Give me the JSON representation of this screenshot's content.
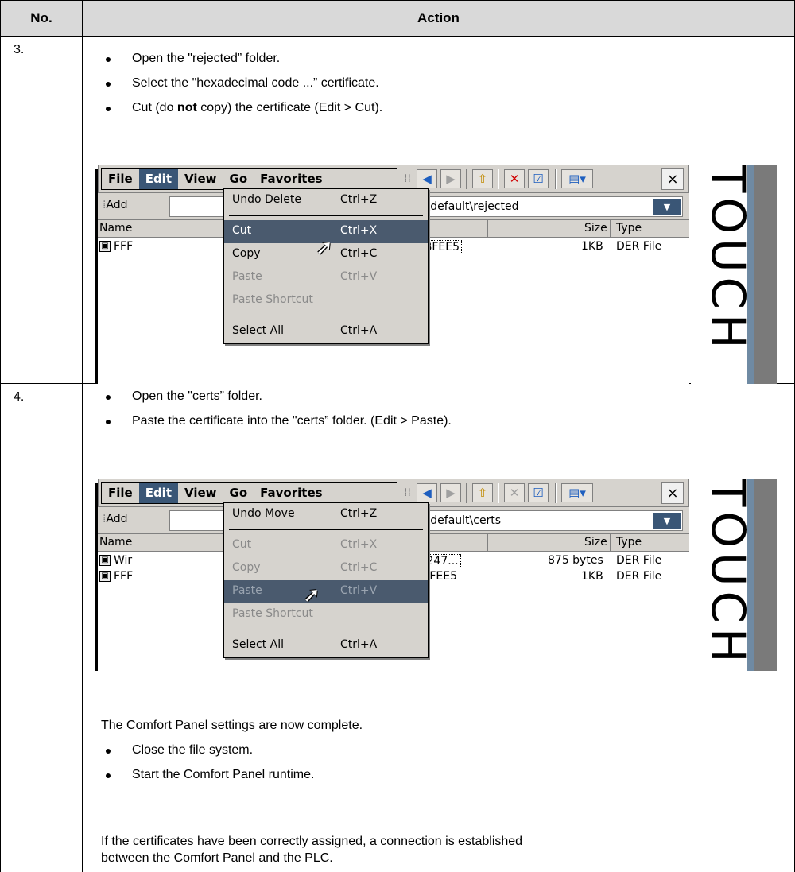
{
  "table": {
    "header_no": "No.",
    "header_action": "Action"
  },
  "rows": [
    {
      "no": "3.",
      "bullets": [
        "Open the \"rejected” folder.",
        "Select the \"hexadecimal code ...” certificate.",
        [
          "Cut (do ",
          "not",
          " copy) the certificate (Edit > Cut)."
        ]
      ],
      "screenshot": {
        "menu": [
          "File",
          "Edit",
          "View",
          "Go",
          "Favorites"
        ],
        "address_label": "Add",
        "address": "ot\\OPC\\PKI\\CA\\default\\rejected",
        "columns": [
          "Name",
          "Size",
          "Type"
        ],
        "files": [
          {
            "name": "FFF",
            "tail": "9000492A54BFEE5",
            "size": "1KB",
            "type": "DER File"
          }
        ],
        "dropdown": [
          {
            "label": "Undo Delete",
            "key": "Ctrl+Z",
            "state": "normal"
          },
          {
            "label": "Cut",
            "key": "Ctrl+X",
            "state": "highlight"
          },
          {
            "label": "Copy",
            "key": "Ctrl+C",
            "state": "normal"
          },
          {
            "label": "Paste",
            "key": "Ctrl+V",
            "state": "disabled"
          },
          {
            "label": "Paste Shortcut",
            "key": "",
            "state": "disabled"
          },
          {
            "label": "Select All",
            "key": "Ctrl+A",
            "state": "normal"
          }
        ],
        "close": "×",
        "side_text": "TOUCH"
      }
    },
    {
      "no": "4.",
      "bullets": [
        "Open the \"certs” folder.",
        "Paste the certificate into the \"certs” folder. (Edit > Paste)."
      ],
      "screenshot": {
        "menu": [
          "File",
          "Edit",
          "View",
          "Go",
          "Favorites"
        ],
        "address_label": "Add",
        "address": "ot\\OPC\\PKI\\CA\\default\\certs",
        "columns": [
          "Name",
          "Size",
          "Type"
        ],
        "files": [
          {
            "name": "Wir",
            "tail": "FFEADCDE21247...",
            "size": "875 bytes",
            "type": "DER File"
          },
          {
            "name": "FFF",
            "tail": "9000492A54BFEE5",
            "size": "1KB",
            "type": "DER File"
          }
        ],
        "dropdown": [
          {
            "label": "Undo Move",
            "key": "Ctrl+Z",
            "state": "normal"
          },
          {
            "label": "Cut",
            "key": "Ctrl+X",
            "state": "disabled"
          },
          {
            "label": "Copy",
            "key": "Ctrl+C",
            "state": "disabled"
          },
          {
            "label": "Paste",
            "key": "Ctrl+V",
            "state": "highlight-disabled"
          },
          {
            "label": "Paste Shortcut",
            "key": "",
            "state": "disabled"
          },
          {
            "label": "Select All",
            "key": "Ctrl+A",
            "state": "normal"
          }
        ],
        "close": "×",
        "side_text": "TOUCH"
      },
      "note": "The Comfort Panel settings are now complete.",
      "bullets2": [
        "Close the file system.",
        "Start the Comfort Panel runtime."
      ],
      "conclusion_1": "If the certificates have been correctly assigned, a connection is established",
      "conclusion_2": "between the Comfort Panel and the PLC."
    }
  ]
}
